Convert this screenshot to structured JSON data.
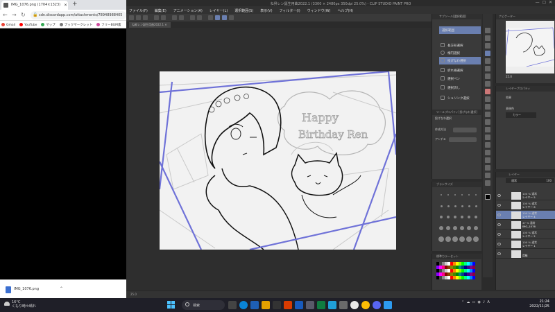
{
  "browser": {
    "tab_title": "IMG_1076.png (1704×1323)",
    "url": "cdn.discordapp.com/attachments/78948988405",
    "bookmarks": [
      "Gmail",
      "YouTube",
      "マップ",
      "ブックマークレット",
      "フリーBGM素"
    ],
    "download_file": "IMG_1076.png"
  },
  "csp": {
    "title": "ね昇レン誕生用曲2022.1 (3300 × 2480px 350dpi 25.0%) - CLIP STUDIO PAINT PRO",
    "menus": [
      "ファイル(F)",
      "編集(E)",
      "アニメーション(A)",
      "レイヤー(L)",
      "選択範囲(S)",
      "表示(V)",
      "フィルター(I)",
      "ウィンドウ(W)",
      "ヘルプ(H)"
    ],
    "doc_tab": "ね昇レン誕生用曲2022.1",
    "status_zoom": "25.0",
    "subtool": {
      "header": "サブツール[選択範囲]",
      "group": "選択範囲",
      "items": [
        "長方形選択",
        "楕円選択",
        "投げなわ選択",
        "折れ線選択",
        "選択ペン",
        "選択消し",
        "シュリンク選択"
      ],
      "selected": "投げなわ選択"
    },
    "tool_property": {
      "header": "ツールプロパティ[投げなわ選択]",
      "tool_name": "投げなわ選択",
      "row1": "作成方法",
      "row2": "アンチエ"
    },
    "brush_size": {
      "header": "ブラシサイズ"
    },
    "color_set": {
      "header": "標準カラーセット"
    },
    "navigator": {
      "header": "ナビゲーター",
      "zoom": "25.0"
    },
    "layer_property": {
      "header": "レイヤープロパティ",
      "effect": "効果",
      "display_color": "表現色",
      "color": "カラー"
    },
    "layers": {
      "header": "レイヤー",
      "blend": "通常",
      "opacity": "100",
      "items": [
        {
          "line1": "100 % 通常",
          "line2": "レイヤー 5"
        },
        {
          "line1": "100 % 通常",
          "line2": "レイヤー 6"
        },
        {
          "line1": "100 % 通常",
          "line2": "レイヤー 4"
        },
        {
          "line1": "47 % 通常",
          "line2": "IMG_1076"
        },
        {
          "line1": "100 % 通常",
          "line2": "レイヤー 2"
        },
        {
          "line1": "100 % 通常",
          "line2": "レイヤー 1"
        },
        {
          "line1": "",
          "line2": "用紙"
        }
      ],
      "selected_index": 2
    }
  },
  "taskbar": {
    "temperature": "16°C",
    "weather": "くもり時々晴れ",
    "search": "検索",
    "time": "21:24",
    "date": "2022/11/25"
  },
  "colors": {
    "accent": "#6a7fb0",
    "frame_blue": "#6f72d8",
    "win_accent": "#4cc2ff"
  },
  "canvas_text": {
    "greeting_1": "Happy",
    "greeting_2": "Birthday Ren"
  }
}
